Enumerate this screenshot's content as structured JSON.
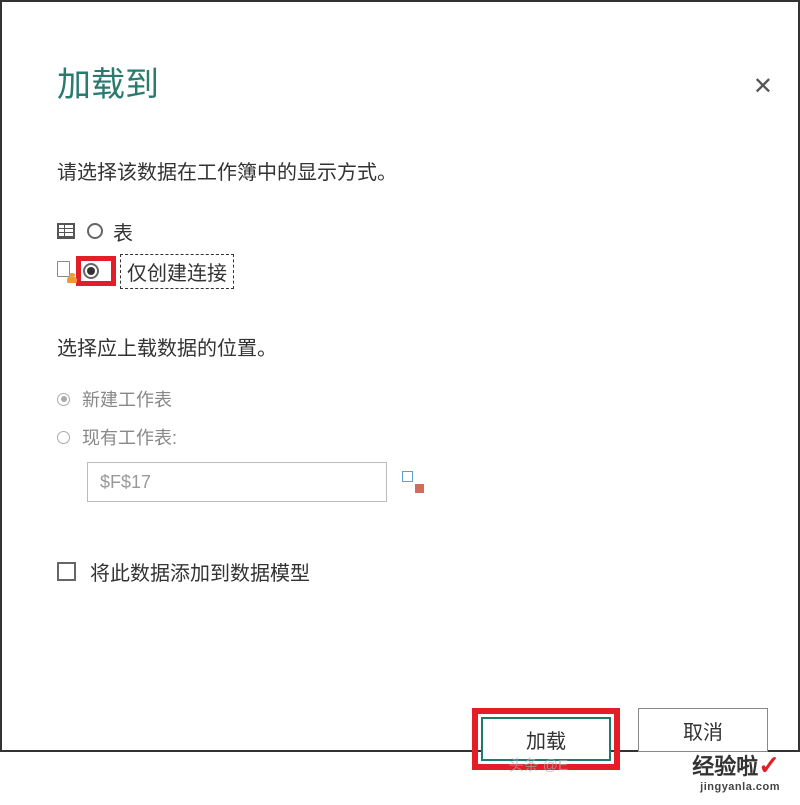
{
  "title": "加载到",
  "display_mode": {
    "prompt": "请选择该数据在工作簿中的显示方式。",
    "options": {
      "table": {
        "label": "表",
        "checked": false
      },
      "connection_only": {
        "label": "仅创建连接",
        "checked": true
      }
    }
  },
  "upload_location": {
    "prompt": "选择应上载数据的位置。",
    "options": {
      "new_sheet": {
        "label": "新建工作表",
        "checked": true
      },
      "existing_sheet": {
        "label": "现有工作表:",
        "checked": false
      }
    },
    "cell_reference": "$F$17"
  },
  "data_model": {
    "label": "将此数据添加到数据模型",
    "checked": false
  },
  "buttons": {
    "load": "加载",
    "cancel": "取消"
  },
  "watermarks": {
    "toutiao": "头条 @E",
    "brand": "经验啦",
    "domain": "jingyanla.com"
  }
}
